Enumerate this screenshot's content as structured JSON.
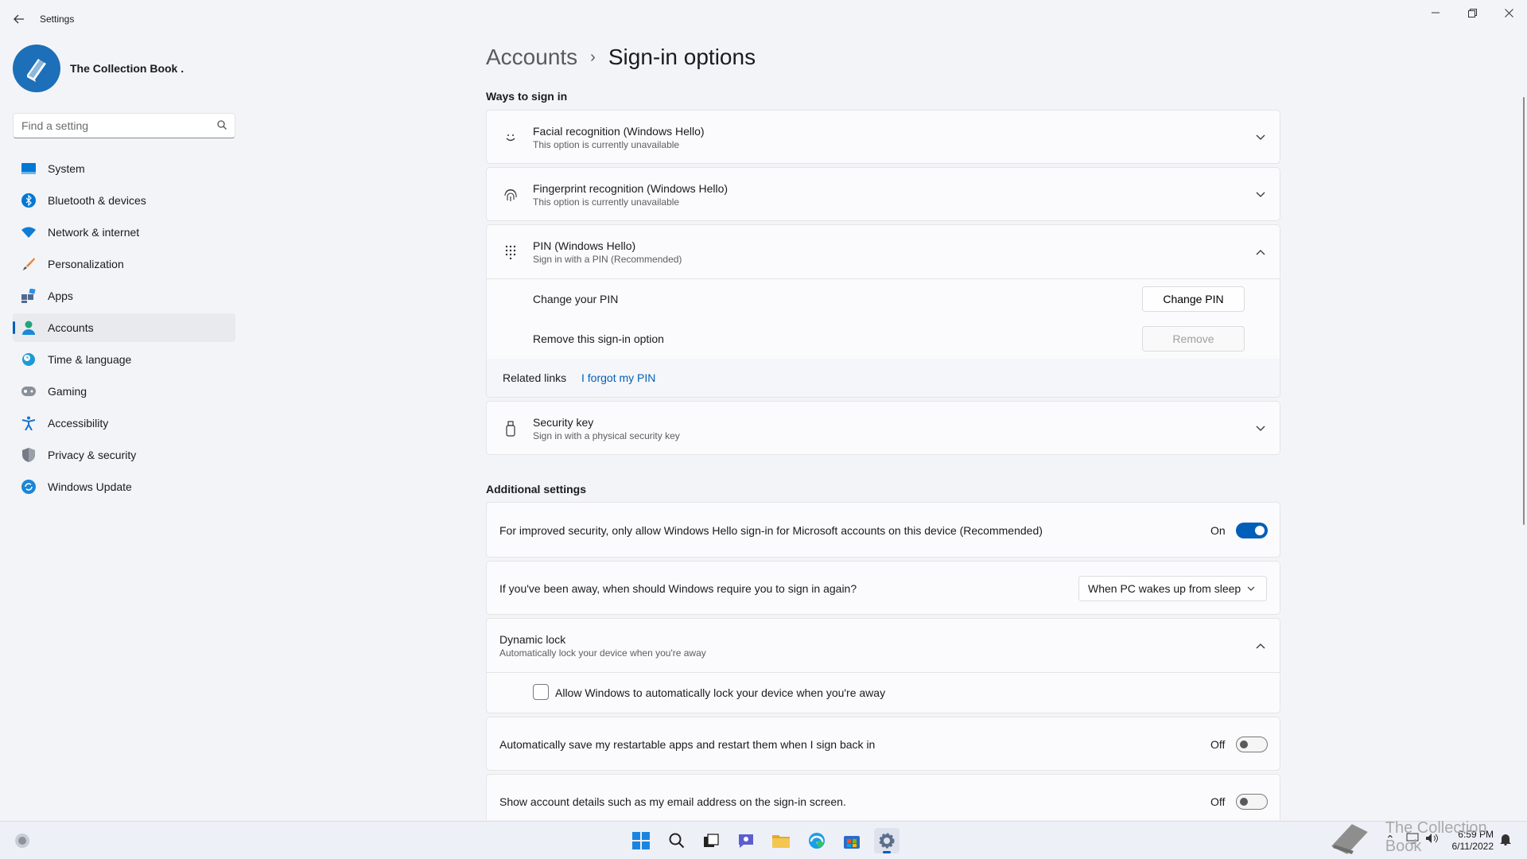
{
  "window": {
    "title": "Settings"
  },
  "profile": {
    "name": "The Collection Book ."
  },
  "search": {
    "placeholder": "Find a setting"
  },
  "sidebar": {
    "items": [
      {
        "label": "System",
        "icon": "monitor-icon"
      },
      {
        "label": "Bluetooth & devices",
        "icon": "bluetooth-icon"
      },
      {
        "label": "Network & internet",
        "icon": "wifi-icon"
      },
      {
        "label": "Personalization",
        "icon": "brush-icon"
      },
      {
        "label": "Apps",
        "icon": "apps-icon"
      },
      {
        "label": "Accounts",
        "icon": "person-icon",
        "selected": true
      },
      {
        "label": "Time & language",
        "icon": "clock-globe-icon"
      },
      {
        "label": "Gaming",
        "icon": "gamepad-icon"
      },
      {
        "label": "Accessibility",
        "icon": "accessibility-icon"
      },
      {
        "label": "Privacy & security",
        "icon": "shield-icon"
      },
      {
        "label": "Windows Update",
        "icon": "update-icon"
      }
    ]
  },
  "breadcrumb": {
    "parent": "Accounts",
    "separator": "›",
    "current": "Sign-in options"
  },
  "ways": {
    "heading": "Ways to sign in",
    "facial": {
      "title": "Facial recognition (Windows Hello)",
      "subtitle": "This option is currently unavailable"
    },
    "fingerprint": {
      "title": "Fingerprint recognition (Windows Hello)",
      "subtitle": "This option is currently unavailable"
    },
    "pin": {
      "title": "PIN (Windows Hello)",
      "subtitle": "Sign in with a PIN (Recommended)",
      "change_label": "Change your PIN",
      "change_button": "Change PIN",
      "remove_label": "Remove this sign-in option",
      "remove_button": "Remove",
      "related_label": "Related links",
      "forgot_link": "I forgot my PIN"
    },
    "security_key": {
      "title": "Security key",
      "subtitle": "Sign in with a physical security key"
    }
  },
  "additional": {
    "heading": "Additional settings",
    "hello_only": {
      "label": "For improved security, only allow Windows Hello sign-in for Microsoft accounts on this device (Recommended)",
      "state": "On"
    },
    "away": {
      "label": "If you've been away, when should Windows require you to sign in again?",
      "value": "When PC wakes up from sleep"
    },
    "dynamic_lock": {
      "title": "Dynamic lock",
      "subtitle": "Automatically lock your device when you're away",
      "checkbox_label": "Allow Windows to automatically lock your device when you're away"
    },
    "restart_apps": {
      "label": "Automatically save my restartable apps and restart them when I sign back in",
      "state": "Off"
    },
    "account_details": {
      "label": "Show account details such as my email address on the sign-in screen.",
      "state": "Off"
    }
  },
  "taskbar": {
    "time": "6:59 PM",
    "date": "6/11/2022"
  },
  "watermark": {
    "text": "The Collection Book"
  },
  "colors": {
    "accent": "#005fb8",
    "background": "#f3f4f8",
    "card": "#fbfbfd"
  }
}
